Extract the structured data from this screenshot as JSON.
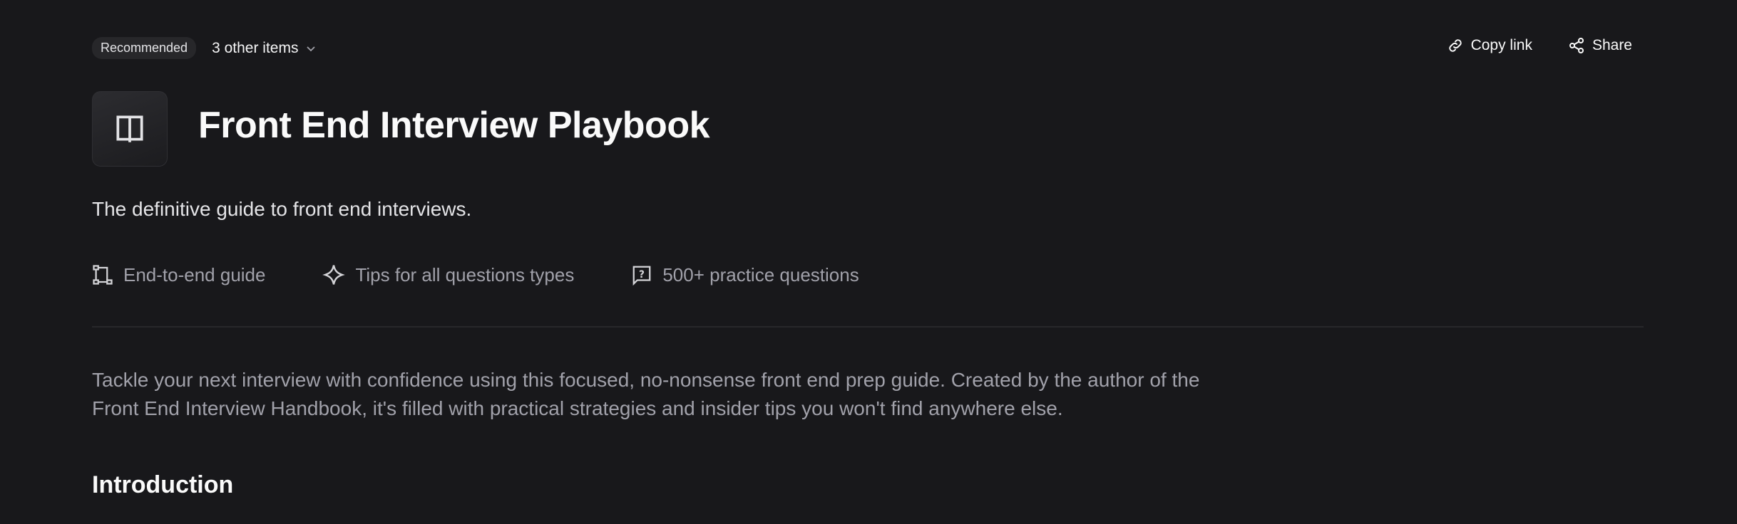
{
  "header": {
    "badge": "Recommended",
    "other_items": "3 other items",
    "copy_link": "Copy link",
    "share": "Share"
  },
  "guide": {
    "title": "Front End Interview Playbook",
    "subtitle": "The definitive guide to front end interviews.",
    "features": [
      {
        "icon": "flow-icon",
        "label": "End-to-end guide"
      },
      {
        "icon": "sparkle-icon",
        "label": "Tips for all questions types"
      },
      {
        "icon": "question-bubble-icon",
        "label": "500+ practice questions"
      }
    ],
    "description_lines": [
      "Tackle your next interview with confidence using this focused, no-nonsense front end prep guide. Created by the author of the",
      "Front End Interview Handbook, it's filled with practical strategies and insider tips you won't find anywhere else."
    ],
    "section_heading": "Introduction"
  }
}
